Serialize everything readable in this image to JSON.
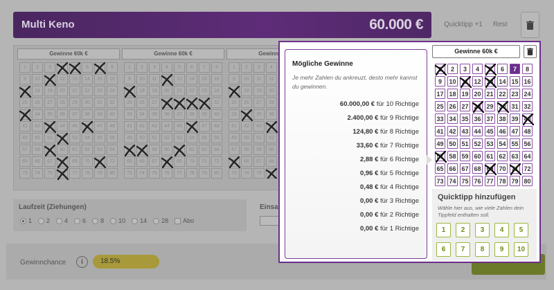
{
  "header": {
    "title": "Multi Keno",
    "amount": "60.000 €",
    "quicktipp_label": "Quicktipp +1",
    "rest_label": "Rest"
  },
  "bg_fields": [
    {
      "label": "Gewinne 60k €"
    },
    {
      "label": "Gewinne 60k €"
    },
    {
      "label": "Gewinne 60k €"
    }
  ],
  "laufzeit": {
    "label": "Laufzeit (Ziehungen)",
    "options": [
      "1",
      "2",
      "4",
      "6",
      "8",
      "10",
      "14",
      "28"
    ],
    "selected": "1",
    "abo_label": "Abo"
  },
  "einsatz_label": "Einsa",
  "chance": {
    "label": "Gewinnchance",
    "info": "i",
    "value": "18.5%"
  },
  "popup": {
    "gains_title": "Mögliche Gewinne",
    "gains_hint": "Je mehr Zahlen du ankreuzt, desto mehr kannst du gewinnen.",
    "gains": [
      {
        "amount": "60.000,00 €",
        "text": "für 10 Richtige"
      },
      {
        "amount": "2.400,00 €",
        "text": "für 9 Richtige"
      },
      {
        "amount": "124,80 €",
        "text": "für 8 Richtige"
      },
      {
        "amount": "33,60 €",
        "text": "für 7 Richtige"
      },
      {
        "amount": "2,88 €",
        "text": "für 6 Richtige"
      },
      {
        "amount": "0,96 €",
        "text": "für 5 Richtige"
      },
      {
        "amount": "0,48 €",
        "text": "für 4 Richtige"
      },
      {
        "amount": "0,00 €",
        "text": "für 3 Richtige"
      },
      {
        "amount": "0,00 €",
        "text": "für 2 Richtige"
      },
      {
        "amount": "0,00 €",
        "text": "für 1 Richtige"
      }
    ],
    "field_label": "Gewinne 60k €",
    "crossed": [
      1,
      5,
      11,
      13,
      28,
      30,
      40,
      57,
      69,
      71
    ],
    "selected": [
      7
    ],
    "quick_title": "Quicktipp hinzufügen",
    "quick_hint": "Wähle hier aus, wie viele Zahlen dein Tippfeld enthalten soll.",
    "quick_options": [
      "1",
      "2",
      "3",
      "4",
      "5",
      "6",
      "7",
      "8",
      "9",
      "10"
    ]
  },
  "colors": {
    "brand_purple": "#6b2d8a",
    "quick_green": "#9ab83a"
  }
}
